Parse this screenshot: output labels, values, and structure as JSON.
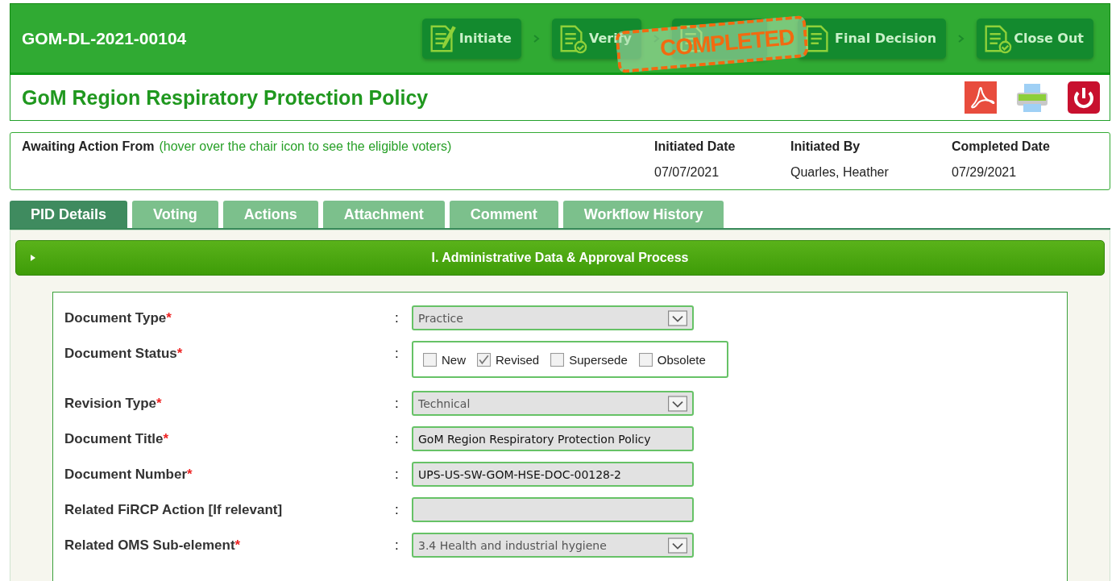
{
  "header": {
    "id": "GOM-DL-2021-00104",
    "steps": [
      {
        "label": "Initiate",
        "covered": false
      },
      {
        "label": "Verify",
        "covered": false
      },
      {
        "covered": true
      },
      {
        "label": "Final Decision",
        "covered": false
      },
      {
        "label": "Close Out",
        "covered": false
      }
    ],
    "stamp": "COMPLETED"
  },
  "title": "GoM Region Respiratory Protection Policy",
  "info": {
    "awaiting_label": "Awaiting Action From",
    "awaiting_hint": "(hover over the chair icon to see the eligible voters)",
    "columns": [
      {
        "label": "Initiated Date",
        "value": "07/07/2021"
      },
      {
        "label": "Initiated By",
        "value": "Quarles, Heather"
      },
      {
        "label": "Completed Date",
        "value": "07/29/2021"
      }
    ]
  },
  "tabs": [
    {
      "label": "PID Details",
      "selected": true
    },
    {
      "label": "Voting",
      "selected": false
    },
    {
      "label": "Actions",
      "selected": false
    },
    {
      "label": "Attachment",
      "selected": false
    },
    {
      "label": "Comment",
      "selected": false
    },
    {
      "label": "Workflow History",
      "selected": false
    }
  ],
  "section": {
    "title": "I. Administrative Data & Approval Process",
    "expanded": false
  },
  "fields": [
    {
      "kind": "select",
      "label": "Document Type",
      "required_mark": "*",
      "colon": ":",
      "value": "Practice"
    },
    {
      "kind": "checkboxes",
      "label": "Document Status",
      "required_mark": "*",
      "colon": ":",
      "options": [
        {
          "label": "New",
          "checked": false
        },
        {
          "label": "Revised",
          "checked": true
        },
        {
          "label": "Supersede",
          "checked": false
        },
        {
          "label": "Obsolete",
          "checked": false
        }
      ]
    },
    {
      "kind": "select",
      "label": "Revision Type",
      "required_mark": "*",
      "colon": ":",
      "value": "Technical"
    },
    {
      "kind": "text",
      "label": "Document Title",
      "required_mark": "*",
      "colon": ":",
      "value": "GoM Region Respiratory Protection Policy"
    },
    {
      "kind": "text",
      "label": "Document Number",
      "required_mark": "*",
      "colon": ":",
      "value": "UPS-US-SW-GOM-HSE-DOC-00128-2"
    },
    {
      "kind": "text",
      "label": "Related FiRCP Action [If relevant]",
      "colon": ":"
    },
    {
      "kind": "select",
      "label": "Related OMS Sub-element",
      "required_mark": "*",
      "colon": ":",
      "value": "3.4 Health and industrial hygiene"
    }
  ]
}
